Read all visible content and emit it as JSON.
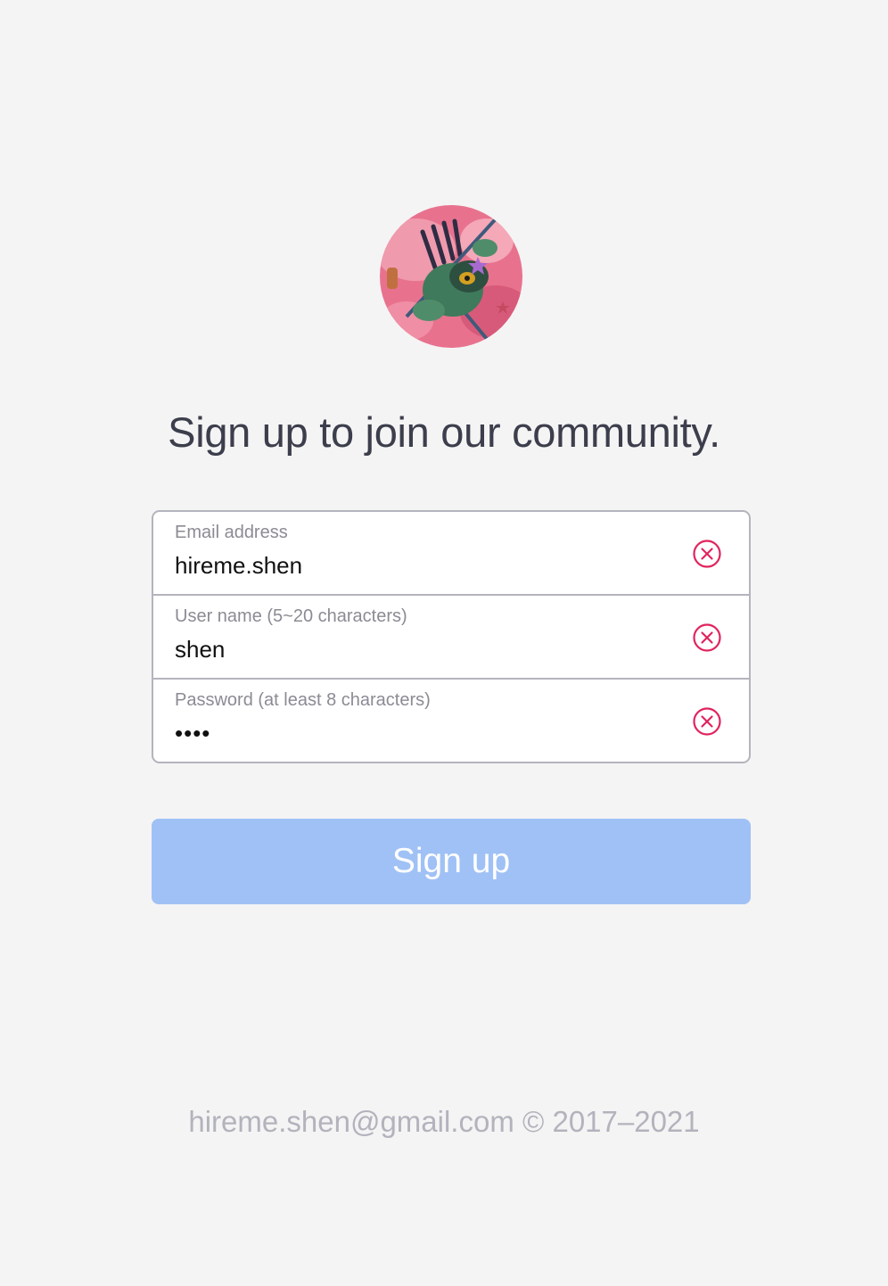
{
  "avatar": {
    "icon": "avatar-illustration"
  },
  "headline": "Sign up to join our community.",
  "form": {
    "fields": [
      {
        "label": "Email address",
        "value": "hireme.shen",
        "type": "text",
        "clear_icon": "clear-circle-x-icon"
      },
      {
        "label": "User name (5~20 characters)",
        "value": "shen",
        "type": "text",
        "clear_icon": "clear-circle-x-icon"
      },
      {
        "label": "Password (at least 8 characters)",
        "value": "••••",
        "type": "password",
        "clear_icon": "clear-circle-x-icon"
      }
    ]
  },
  "submit_label": "Sign up",
  "footer": "hireme.shen@gmail.com © 2017–2021",
  "colors": {
    "background": "#f4f4f4",
    "headline": "#3c3e4c",
    "button_disabled": "#a0c1f5",
    "clear_icon": "#e0245e",
    "field_border": "#b4b4be",
    "footer_text": "#b3b3bd"
  }
}
